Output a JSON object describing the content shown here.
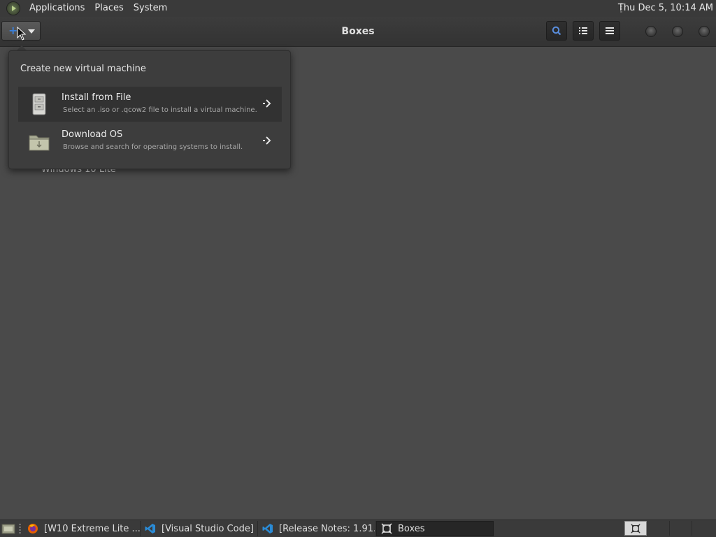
{
  "top_panel": {
    "menus": [
      "Applications",
      "Places",
      "System"
    ],
    "clock": "Thu Dec  5, 10:14 AM"
  },
  "header": {
    "title": "Boxes",
    "new_button_icon": "plus-icon",
    "accent_color": "#3b7fd8"
  },
  "background_item": "Windows 10 Lite",
  "popover": {
    "heading": "Create new virtual machine",
    "options": [
      {
        "title": "Install from File",
        "description": "Select an .iso or .qcow2 file to install a virtual machine.",
        "icon": "file-cabinet-icon"
      },
      {
        "title": "Download OS",
        "description": "Browse and search for operating systems to install.",
        "icon": "folder-download-icon"
      }
    ]
  },
  "taskbar": {
    "tasks": [
      {
        "label": "[W10 Extreme Lite ...",
        "icon": "firefox-icon"
      },
      {
        "label": "[Visual Studio Code]",
        "icon": "vscode-icon"
      },
      {
        "label": "[Release Notes: 1.91...",
        "icon": "vscode-icon"
      },
      {
        "label": "Boxes",
        "icon": "boxes-icon",
        "active": true
      }
    ]
  }
}
